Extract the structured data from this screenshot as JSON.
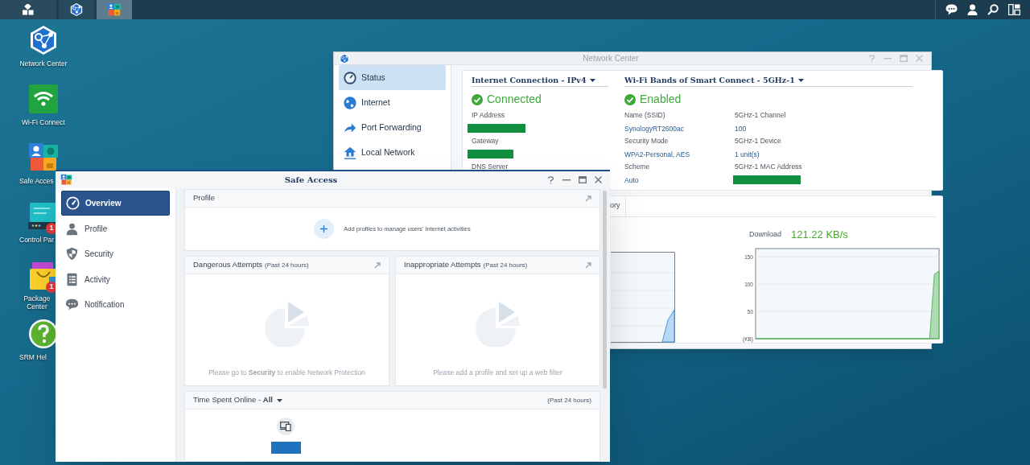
{
  "taskbar": {
    "apps": [
      {
        "kind": "network",
        "selected": false
      },
      {
        "kind": "safe-access",
        "selected": true
      }
    ]
  },
  "desktop_icons": [
    {
      "kind": "network",
      "label": "Network Center"
    },
    {
      "kind": "wifi",
      "label": "Wi-Fi Connect"
    },
    {
      "kind": "safe-access",
      "label": "Safe Acces"
    },
    {
      "kind": "control-panel",
      "label": "Control Par",
      "badge": "1"
    },
    {
      "kind": "package",
      "label": "Package Center",
      "badge": "1"
    },
    {
      "kind": "help",
      "label": "SRM Hel"
    }
  ],
  "network_center": {
    "title": "Network Center",
    "sidebar": [
      {
        "kind": "status",
        "label": "Status",
        "selected": true
      },
      {
        "kind": "internet",
        "label": "Internet",
        "selected": false
      },
      {
        "kind": "port-forwarding",
        "label": "Port Forwarding",
        "selected": false
      },
      {
        "kind": "local-network",
        "label": "Local Network",
        "selected": false
      }
    ],
    "internet_connection": {
      "header": "Internet Connection - IPv4",
      "status": "Connected",
      "fields": [
        {
          "label": "IP Address",
          "redacted": true
        },
        {
          "label": "Gateway",
          "redacted": true
        },
        {
          "label": "DNS Server"
        }
      ]
    },
    "wifi_bands": {
      "header": "Wi-Fi Bands of Smart Connect - 5GHz-1",
      "status": "Enabled",
      "fields": [
        {
          "label": "Name (SSID)",
          "value": "SynologyRT2600ac"
        },
        {
          "label": "5GHz-1 Channel",
          "value": "100"
        },
        {
          "label": "Security Mode",
          "value": "WPA2-Personal, AES"
        },
        {
          "label": "5GHz-1 Device",
          "value": "1 unit(s)"
        },
        {
          "label": "Scheme",
          "value": "Auto"
        },
        {
          "label": "5GHz-1 MAC Address",
          "redacted": true
        }
      ]
    },
    "traffic": {
      "tab": "ory",
      "download_value": "121.22 KB/s",
      "chart_data": {
        "type": "area",
        "grid": true,
        "ylim": [
          0,
          165
        ],
        "yticks": [
          {
            "value": 0,
            "label": "(KB)"
          },
          50,
          100,
          150
        ],
        "series": [
          {
            "name": "Download",
            "color": "#5cb85c",
            "values": [
              0,
              0,
              0,
              0,
              0,
              0,
              0,
              0,
              0,
              0,
              0,
              0,
              0,
              0,
              0,
              0,
              0,
              0,
              0,
              0,
              0,
              0,
              0,
              0,
              0,
              0,
              0,
              0,
              0,
              0,
              0,
              0,
              0,
              0,
              0,
              0,
              0,
              0,
              118,
              124
            ]
          }
        ]
      }
    }
  },
  "safe_access": {
    "title": "Safe Access",
    "sidebar": [
      {
        "kind": "overview",
        "label": "Overview",
        "selected": true
      },
      {
        "kind": "profile",
        "label": "Profile",
        "selected": false
      },
      {
        "kind": "security",
        "label": "Security",
        "selected": false
      },
      {
        "kind": "activity",
        "label": "Activity",
        "selected": false
      },
      {
        "kind": "notification",
        "label": "Notification",
        "selected": false
      }
    ],
    "profile_widget": {
      "title": "Profile",
      "message": "Add profiles to manage users' Internet activities"
    },
    "attempt_widgets": [
      {
        "title": "Dangerous Attempts",
        "period": "(Past 24 hours)",
        "message": "Please go to **Security** to enable Network Protection"
      },
      {
        "title": "Inappropriate Attempts",
        "period": "(Past 24 hours)",
        "message": "Please add a profile and set up a web filter"
      }
    ],
    "time_widget": {
      "title": "Time Spent Online - **All**",
      "period": "(Past 24 hours)"
    }
  }
}
